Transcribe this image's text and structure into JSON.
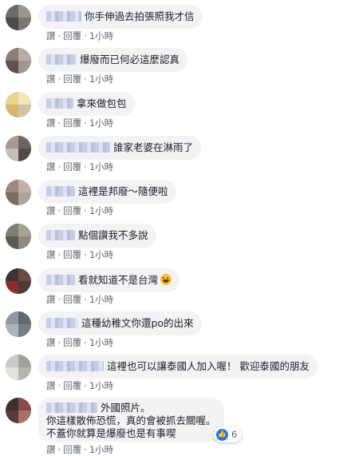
{
  "actions": {
    "like": "讚",
    "reply": "回覆",
    "separator": "·"
  },
  "comments": [
    {
      "text": "你手伸過去拍張照我才信",
      "time": "1小時"
    },
    {
      "text": "爆廢而已何必這麼認真",
      "time": "1小時"
    },
    {
      "text": "拿來做包包",
      "time": "1小時"
    },
    {
      "text": "誰家老婆在淋雨了",
      "time": "1小時"
    },
    {
      "text": "這裡是邦廢～隨便啦",
      "time": "1小時"
    },
    {
      "text": "點個讚我不多說",
      "time": "1小時"
    },
    {
      "text": "看就知道不是台灣",
      "time": "1小時",
      "emoji": "grinning-squinting-face"
    },
    {
      "text": "這種幼稚文你還po的出來",
      "time": "1小時"
    },
    {
      "text": "這裡也可以讓泰國人加入喔！ 歡迎泰國的朋友",
      "time": "1小時"
    },
    {
      "lines": [
        "外國照片。",
        "你這樣散佈恐慌，真的會被抓去關喔。",
        "不蓋你就算是爆廢也是有事喫"
      ],
      "time": "1小時",
      "reaction_count": "6"
    }
  ],
  "colors": {
    "bubble": "#f2f3f5",
    "meta_text": "#606770",
    "like_blue": "#1877f2"
  }
}
